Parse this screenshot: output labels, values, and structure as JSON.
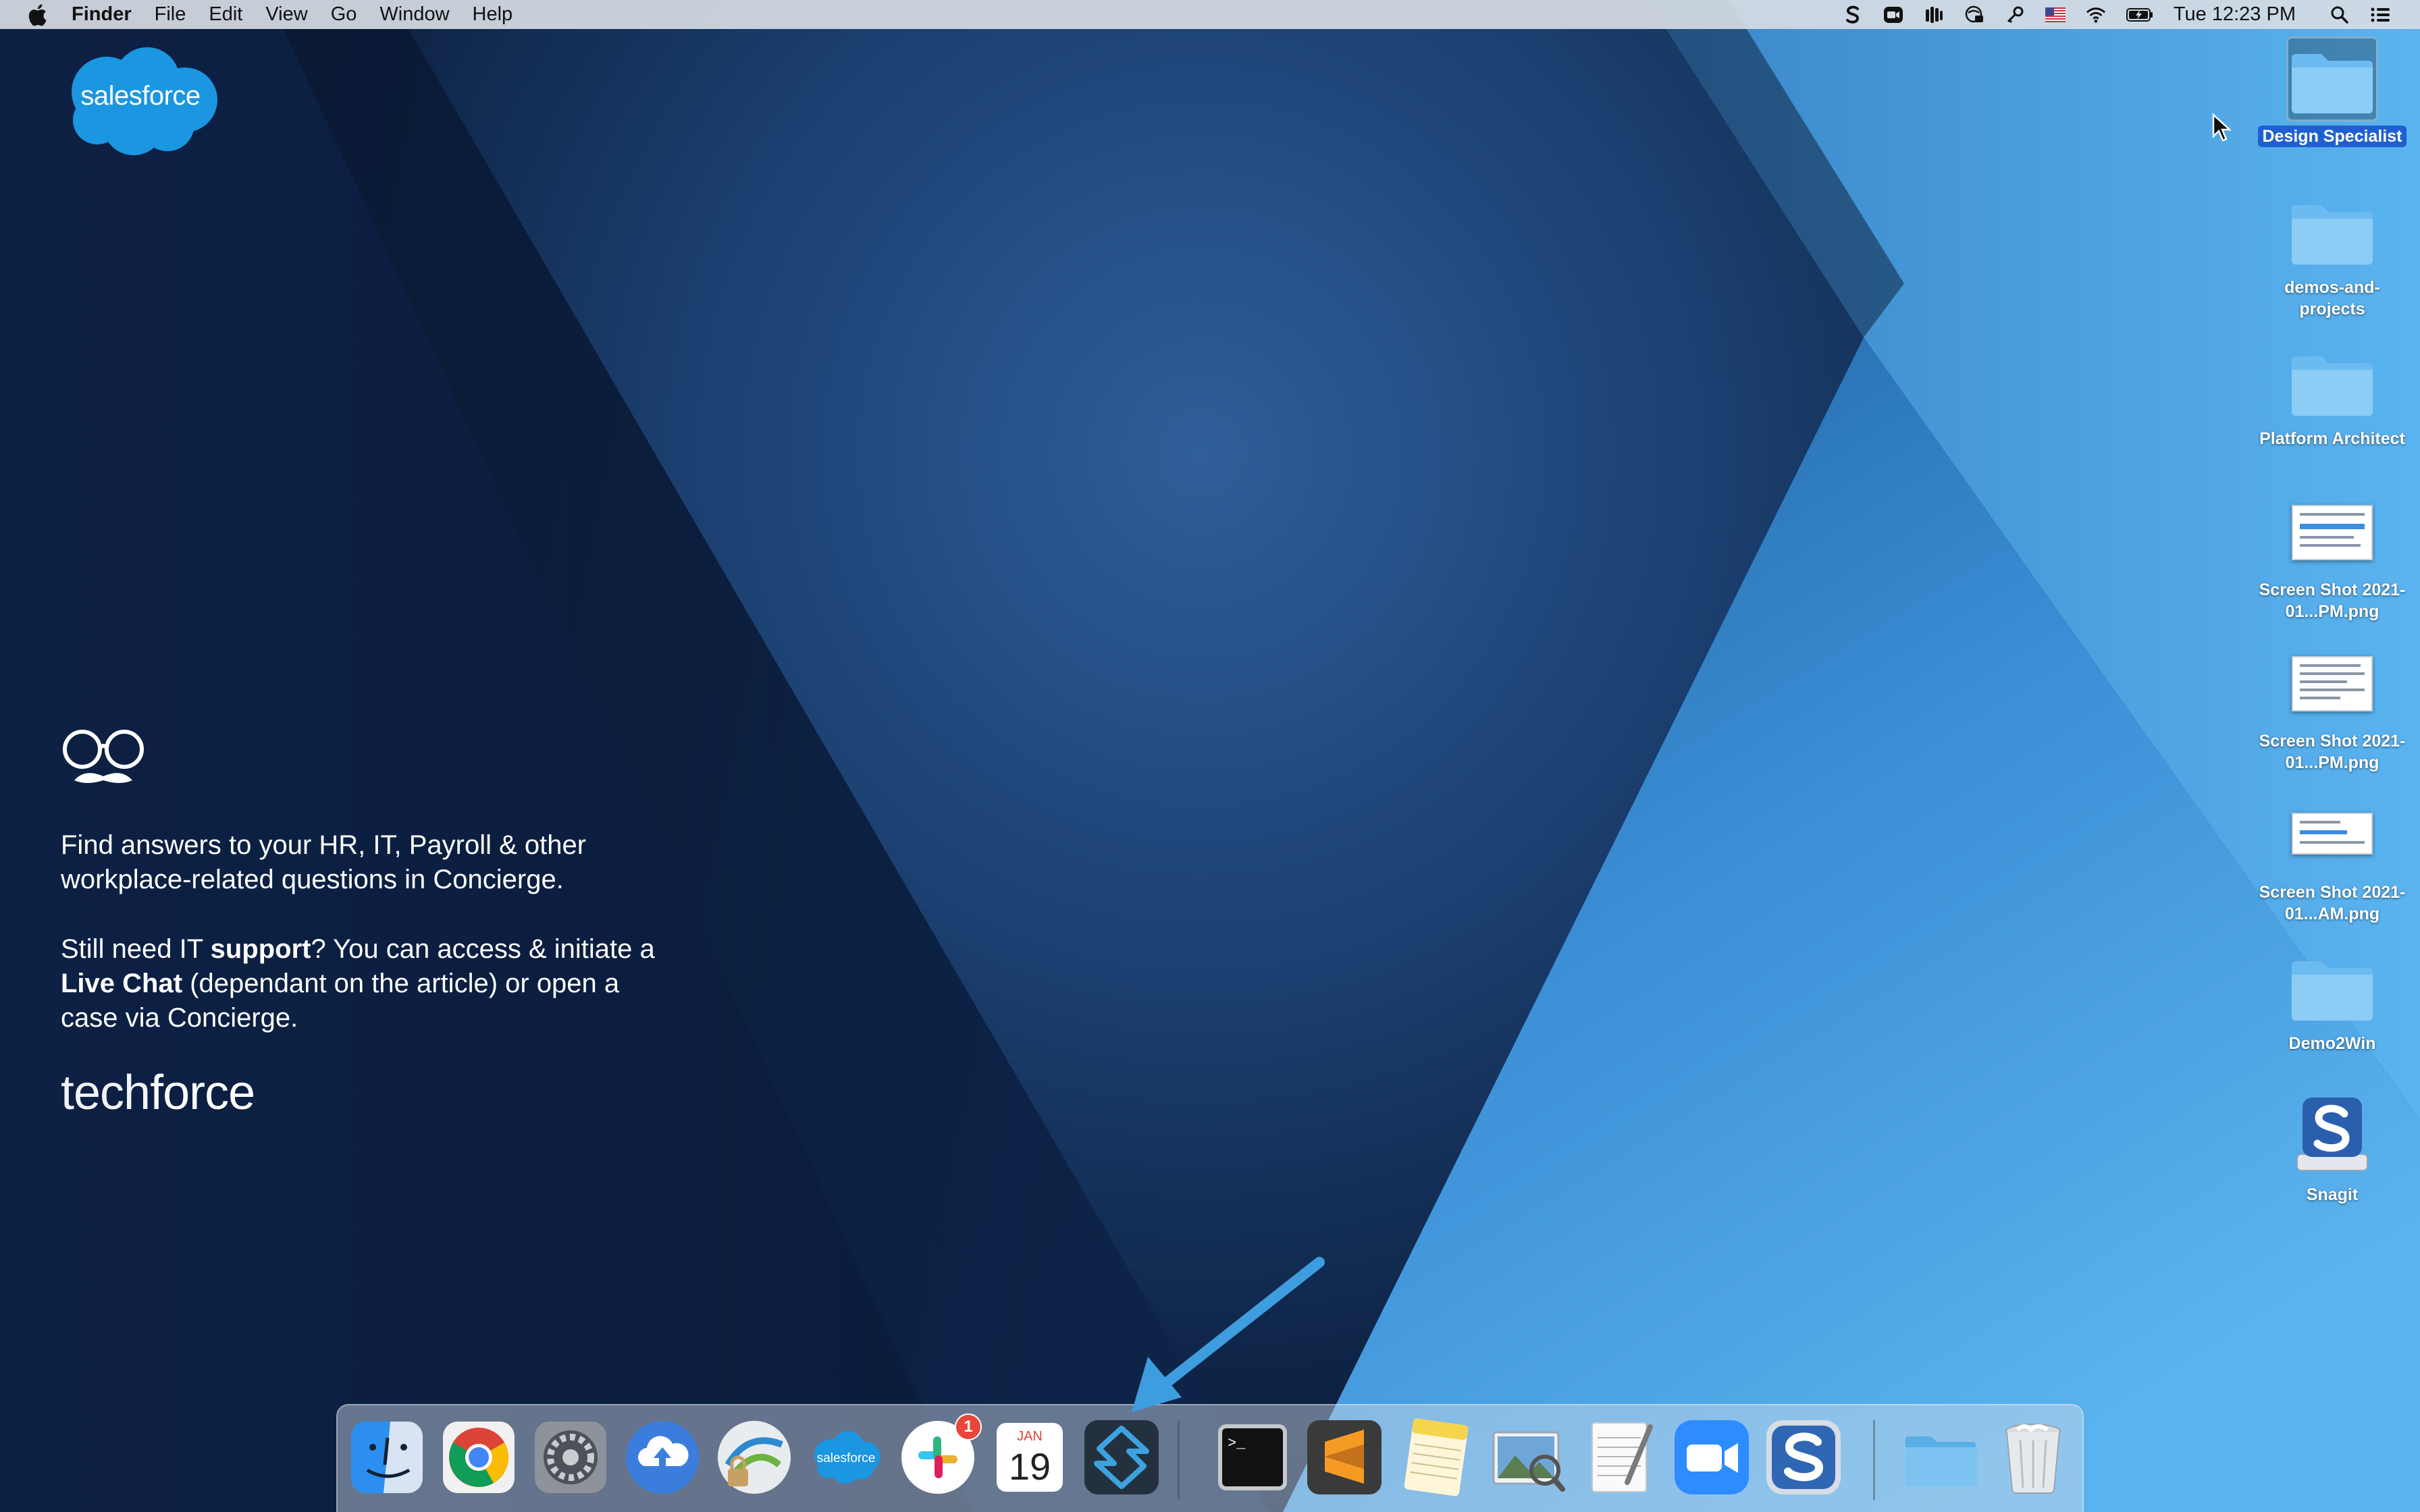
{
  "menubar": {
    "app_name": "Finder",
    "items": [
      "File",
      "Edit",
      "View",
      "Go",
      "Window",
      "Help"
    ],
    "clock": "Tue 12:23 PM",
    "status_icons": [
      "snagit-icon",
      "zoom-icon",
      "audio-bars-icon",
      "vpn-icon",
      "key-icon",
      "us-flag-icon",
      "wifi-icon",
      "battery-icon",
      "search-icon",
      "notification-center-icon"
    ]
  },
  "wallpaper": {
    "logo_text": "salesforce",
    "para1": "Find answers to your HR, IT, Payroll & other workplace-related questions in Concierge.",
    "para2": {
      "t1": "Still need IT ",
      "b1": "support",
      "t2": "? You can access & initiate a ",
      "b2": "Live Chat",
      "t3": " (dependant on the article) or open a case via Concierge."
    },
    "brand_light": "tech",
    "brand_bold": "force"
  },
  "desktop": {
    "items": [
      {
        "label": "Design Specialist",
        "kind": "folder",
        "selected": true
      },
      {
        "label": "demos-and-projects",
        "kind": "folder"
      },
      {
        "label": "Platform Architect",
        "kind": "folder"
      },
      {
        "label": "Screen Shot 2021-01...PM.png",
        "kind": "image"
      },
      {
        "label": "Screen Shot 2021-01...PM.png",
        "kind": "image"
      },
      {
        "label": "Screen Shot 2021-01...AM.png",
        "kind": "image"
      },
      {
        "label": "Demo2Win",
        "kind": "folder"
      },
      {
        "label": "Snagit",
        "kind": "drive"
      }
    ]
  },
  "dock": {
    "items": [
      {
        "name": "finder-icon"
      },
      {
        "name": "chrome-icon"
      },
      {
        "name": "system-preferences-icon"
      },
      {
        "name": "cloud-upload-icon"
      },
      {
        "name": "vpn-client-icon"
      },
      {
        "name": "salesforce-icon",
        "label": "salesforce"
      },
      {
        "name": "slack-icon",
        "badge": "1"
      },
      {
        "name": "calendar-icon",
        "month": "JAN",
        "day": "19"
      },
      {
        "name": "streamline-icon"
      },
      {
        "name": "terminal-icon",
        "prompt": ">_"
      },
      {
        "name": "sublime-text-icon"
      },
      {
        "name": "notes-icon"
      },
      {
        "name": "preview-icon"
      },
      {
        "name": "textedit-icon"
      },
      {
        "name": "zoom-icon"
      },
      {
        "name": "snagit-icon"
      },
      {
        "name": "downloads-folder-icon"
      },
      {
        "name": "trash-icon"
      }
    ]
  },
  "colors": {
    "menubar": "#d6dce4",
    "selection": "#1f5fd1",
    "annotation_arrow": "#3d9ddf",
    "badge": "#e7463a"
  }
}
